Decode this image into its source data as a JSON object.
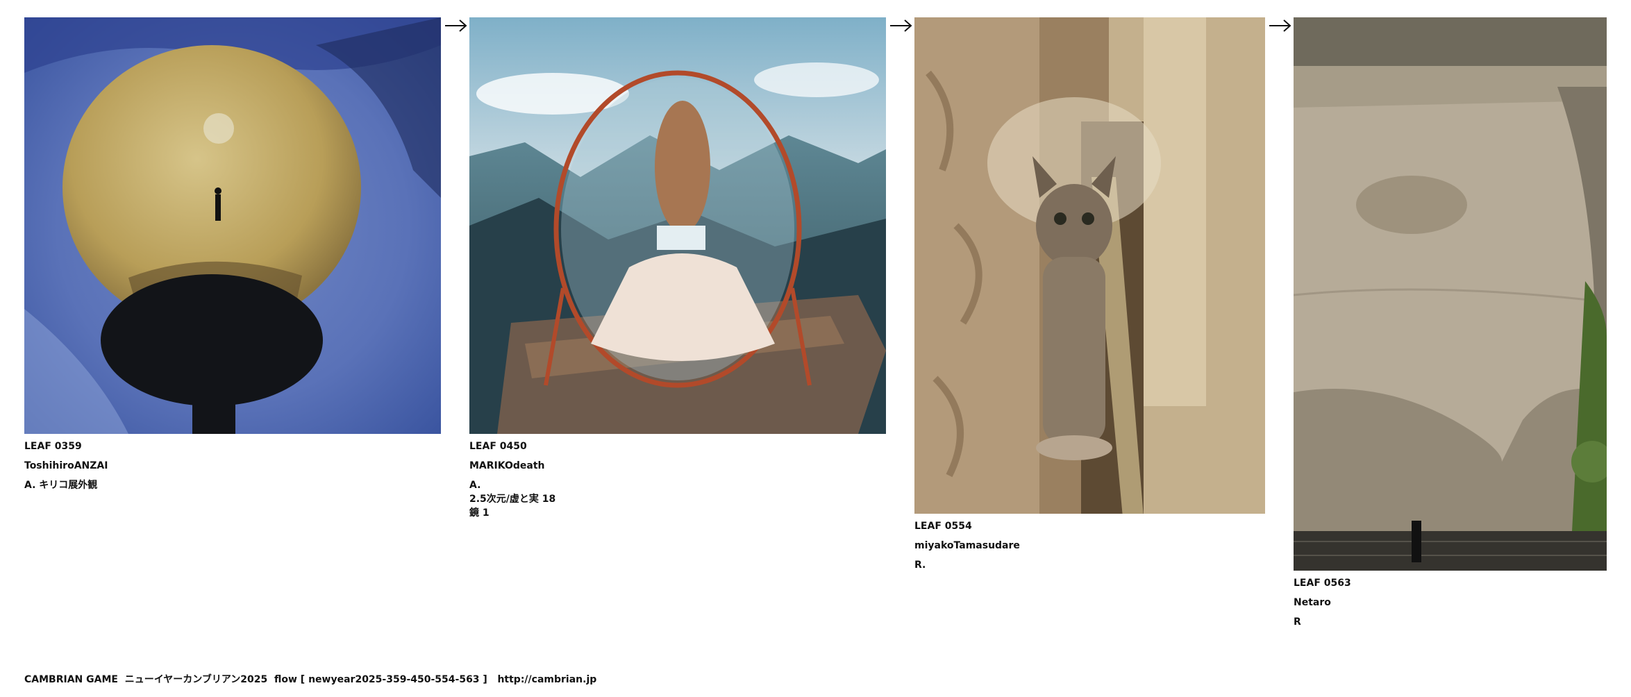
{
  "leaves": [
    {
      "id": "LEAF 0359",
      "author": "ToshihiroANZAI",
      "title": "A. キリコ展外観",
      "image": "painting-golden-sphere-on-blue"
    },
    {
      "id": "LEAF 0450",
      "author": "MARIKOdeath",
      "title": "A.\n2.5次元/虚と実 18\n鏡 1",
      "image": "photo-girl-with-mirror-on-mountain"
    },
    {
      "id": "LEAF 0554",
      "author": "miyakoTamasudare",
      "title": "R.",
      "image": "photo-cat-with-cone-collar"
    },
    {
      "id": "LEAF 0563",
      "author": "Netaro",
      "title": "R",
      "image": "photo-bridge-underside-shadow"
    }
  ],
  "arrow_icon": "right-arrow-icon",
  "footer": {
    "text": "CAMBRIAN GAME  ニューイヤーカンブリアン2025  flow [ newyear2025-359-450-554-563 ]   ",
    "link": "http://cambrian.jp"
  }
}
